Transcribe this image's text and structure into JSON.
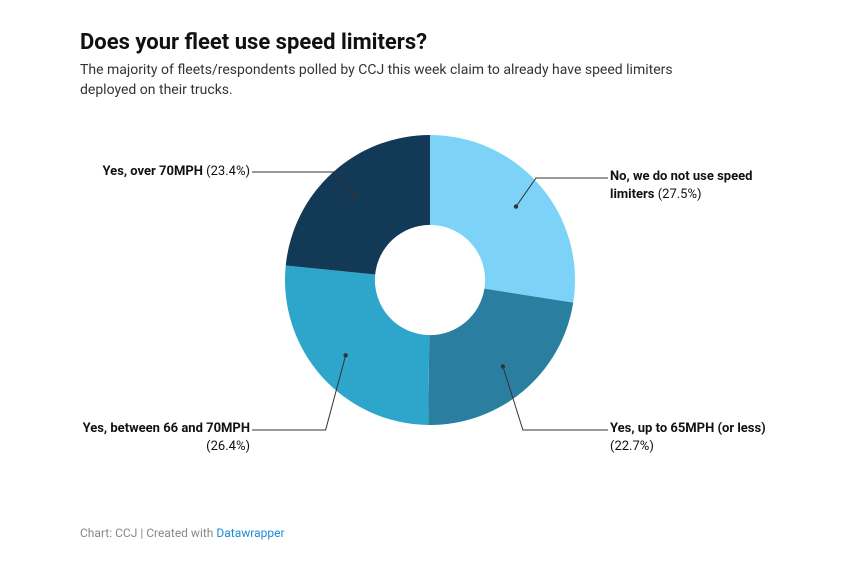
{
  "title": "Does your fleet use speed limiters?",
  "subtitle": "The majority of fleets/respondents polled by CCJ this week claim to already have speed limiters deployed on their trucks.",
  "footer_prefix": "Chart: CCJ | Created with ",
  "footer_link_text": "Datawrapper",
  "labels": {
    "seg0_name": "No, we do not use speed limiters",
    "seg0_pct": "(27.5%)",
    "seg1_name": "Yes, up to 65MPH (or less)",
    "seg1_pct": "(22.7%)",
    "seg2_name": "Yes, between 66 and 70MPH",
    "seg2_pct": "(26.4%)",
    "seg3_name": "Yes, over 70MPH",
    "seg3_pct": "(23.4%)"
  },
  "chart_data": {
    "type": "pie",
    "title": "Does your fleet use speed limiters?",
    "series": [
      {
        "name": "No, we do not use speed limiters",
        "value": 27.5,
        "color": "#7dd3f7"
      },
      {
        "name": "Yes, up to 65MPH (or less)",
        "value": 22.7,
        "color": "#2a7ea0"
      },
      {
        "name": "Yes, between 66 and 70MPH",
        "value": 26.4,
        "color": "#2ea6cc"
      },
      {
        "name": "Yes, over 70MPH",
        "value": 23.4,
        "color": "#123a57"
      }
    ],
    "inner_radius": 0.38,
    "start_angle_deg": -90
  }
}
